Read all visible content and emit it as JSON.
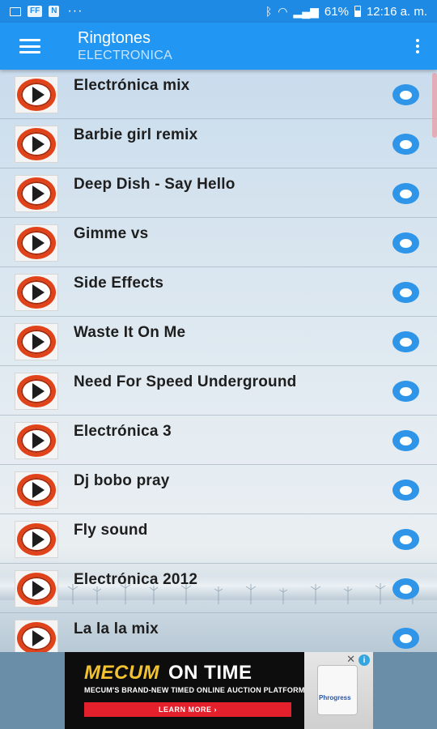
{
  "status_bar": {
    "left_icons": [
      "FF",
      "N"
    ],
    "dots": "···",
    "battery": "61%",
    "time": "12:16 a. m."
  },
  "appbar": {
    "title": "Ringtones",
    "subtitle": "ELECTRONICA"
  },
  "ringtones": [
    "Electrónica mix",
    "Barbie girl remix",
    "Deep Dish - Say Hello",
    "Gimme vs",
    "Side Effects",
    "Waste It On Me",
    "Need For Speed Underground",
    "Electrónica 3",
    "Dj bobo pray",
    "Fly sound",
    "Electrónica 2012",
    "La la la mix"
  ],
  "ad": {
    "brand": "MECUM",
    "tagline": "ON TIME",
    "subline": "MECUM'S BRAND-NEW TIMED ONLINE AUCTION PLATFORM",
    "cta": "LEARN MORE ›",
    "product_label": "Phrogress",
    "badge": "i"
  },
  "colors": {
    "appbar": "#2196f3",
    "statusbar": "#1f8ae3",
    "play_ring": "#e04319",
    "pick_button": "#2e95e8",
    "ad_cta": "#e3202b",
    "ad_brand": "#f2c230"
  }
}
